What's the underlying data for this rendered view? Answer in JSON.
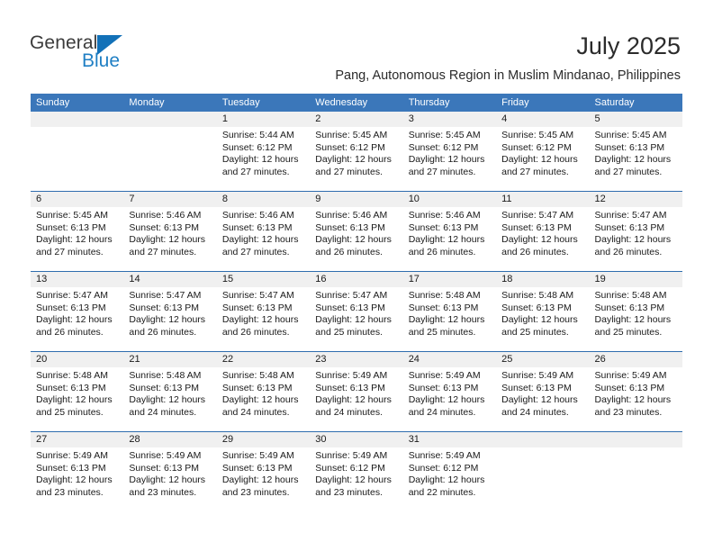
{
  "brand": {
    "name_top": "General",
    "name_bottom": "Blue",
    "triangle_color": "#1271b8",
    "blue_text_color": "#1f7fc4"
  },
  "header": {
    "title": "July 2025",
    "subtitle": "Pang, Autonomous Region in Muslim Mindanao, Philippines",
    "header_bg": "#3b77ba",
    "header_text": "#ffffff",
    "daynum_band_bg": "#f0f0f0",
    "row_divider": "#2f6dae"
  },
  "weekday_headers": [
    "Sunday",
    "Monday",
    "Tuesday",
    "Wednesday",
    "Thursday",
    "Friday",
    "Saturday"
  ],
  "weeks": [
    [
      {
        "day": "",
        "sunrise": "",
        "sunset": "",
        "daylight_line1": "",
        "daylight_line2": ""
      },
      {
        "day": "",
        "sunrise": "",
        "sunset": "",
        "daylight_line1": "",
        "daylight_line2": ""
      },
      {
        "day": "1",
        "sunrise": "Sunrise: 5:44 AM",
        "sunset": "Sunset: 6:12 PM",
        "daylight_line1": "Daylight: 12 hours",
        "daylight_line2": "and 27 minutes."
      },
      {
        "day": "2",
        "sunrise": "Sunrise: 5:45 AM",
        "sunset": "Sunset: 6:12 PM",
        "daylight_line1": "Daylight: 12 hours",
        "daylight_line2": "and 27 minutes."
      },
      {
        "day": "3",
        "sunrise": "Sunrise: 5:45 AM",
        "sunset": "Sunset: 6:12 PM",
        "daylight_line1": "Daylight: 12 hours",
        "daylight_line2": "and 27 minutes."
      },
      {
        "day": "4",
        "sunrise": "Sunrise: 5:45 AM",
        "sunset": "Sunset: 6:12 PM",
        "daylight_line1": "Daylight: 12 hours",
        "daylight_line2": "and 27 minutes."
      },
      {
        "day": "5",
        "sunrise": "Sunrise: 5:45 AM",
        "sunset": "Sunset: 6:13 PM",
        "daylight_line1": "Daylight: 12 hours",
        "daylight_line2": "and 27 minutes."
      }
    ],
    [
      {
        "day": "6",
        "sunrise": "Sunrise: 5:45 AM",
        "sunset": "Sunset: 6:13 PM",
        "daylight_line1": "Daylight: 12 hours",
        "daylight_line2": "and 27 minutes."
      },
      {
        "day": "7",
        "sunrise": "Sunrise: 5:46 AM",
        "sunset": "Sunset: 6:13 PM",
        "daylight_line1": "Daylight: 12 hours",
        "daylight_line2": "and 27 minutes."
      },
      {
        "day": "8",
        "sunrise": "Sunrise: 5:46 AM",
        "sunset": "Sunset: 6:13 PM",
        "daylight_line1": "Daylight: 12 hours",
        "daylight_line2": "and 27 minutes."
      },
      {
        "day": "9",
        "sunrise": "Sunrise: 5:46 AM",
        "sunset": "Sunset: 6:13 PM",
        "daylight_line1": "Daylight: 12 hours",
        "daylight_line2": "and 26 minutes."
      },
      {
        "day": "10",
        "sunrise": "Sunrise: 5:46 AM",
        "sunset": "Sunset: 6:13 PM",
        "daylight_line1": "Daylight: 12 hours",
        "daylight_line2": "and 26 minutes."
      },
      {
        "day": "11",
        "sunrise": "Sunrise: 5:47 AM",
        "sunset": "Sunset: 6:13 PM",
        "daylight_line1": "Daylight: 12 hours",
        "daylight_line2": "and 26 minutes."
      },
      {
        "day": "12",
        "sunrise": "Sunrise: 5:47 AM",
        "sunset": "Sunset: 6:13 PM",
        "daylight_line1": "Daylight: 12 hours",
        "daylight_line2": "and 26 minutes."
      }
    ],
    [
      {
        "day": "13",
        "sunrise": "Sunrise: 5:47 AM",
        "sunset": "Sunset: 6:13 PM",
        "daylight_line1": "Daylight: 12 hours",
        "daylight_line2": "and 26 minutes."
      },
      {
        "day": "14",
        "sunrise": "Sunrise: 5:47 AM",
        "sunset": "Sunset: 6:13 PM",
        "daylight_line1": "Daylight: 12 hours",
        "daylight_line2": "and 26 minutes."
      },
      {
        "day": "15",
        "sunrise": "Sunrise: 5:47 AM",
        "sunset": "Sunset: 6:13 PM",
        "daylight_line1": "Daylight: 12 hours",
        "daylight_line2": "and 26 minutes."
      },
      {
        "day": "16",
        "sunrise": "Sunrise: 5:47 AM",
        "sunset": "Sunset: 6:13 PM",
        "daylight_line1": "Daylight: 12 hours",
        "daylight_line2": "and 25 minutes."
      },
      {
        "day": "17",
        "sunrise": "Sunrise: 5:48 AM",
        "sunset": "Sunset: 6:13 PM",
        "daylight_line1": "Daylight: 12 hours",
        "daylight_line2": "and 25 minutes."
      },
      {
        "day": "18",
        "sunrise": "Sunrise: 5:48 AM",
        "sunset": "Sunset: 6:13 PM",
        "daylight_line1": "Daylight: 12 hours",
        "daylight_line2": "and 25 minutes."
      },
      {
        "day": "19",
        "sunrise": "Sunrise: 5:48 AM",
        "sunset": "Sunset: 6:13 PM",
        "daylight_line1": "Daylight: 12 hours",
        "daylight_line2": "and 25 minutes."
      }
    ],
    [
      {
        "day": "20",
        "sunrise": "Sunrise: 5:48 AM",
        "sunset": "Sunset: 6:13 PM",
        "daylight_line1": "Daylight: 12 hours",
        "daylight_line2": "and 25 minutes."
      },
      {
        "day": "21",
        "sunrise": "Sunrise: 5:48 AM",
        "sunset": "Sunset: 6:13 PM",
        "daylight_line1": "Daylight: 12 hours",
        "daylight_line2": "and 24 minutes."
      },
      {
        "day": "22",
        "sunrise": "Sunrise: 5:48 AM",
        "sunset": "Sunset: 6:13 PM",
        "daylight_line1": "Daylight: 12 hours",
        "daylight_line2": "and 24 minutes."
      },
      {
        "day": "23",
        "sunrise": "Sunrise: 5:49 AM",
        "sunset": "Sunset: 6:13 PM",
        "daylight_line1": "Daylight: 12 hours",
        "daylight_line2": "and 24 minutes."
      },
      {
        "day": "24",
        "sunrise": "Sunrise: 5:49 AM",
        "sunset": "Sunset: 6:13 PM",
        "daylight_line1": "Daylight: 12 hours",
        "daylight_line2": "and 24 minutes."
      },
      {
        "day": "25",
        "sunrise": "Sunrise: 5:49 AM",
        "sunset": "Sunset: 6:13 PM",
        "daylight_line1": "Daylight: 12 hours",
        "daylight_line2": "and 24 minutes."
      },
      {
        "day": "26",
        "sunrise": "Sunrise: 5:49 AM",
        "sunset": "Sunset: 6:13 PM",
        "daylight_line1": "Daylight: 12 hours",
        "daylight_line2": "and 23 minutes."
      }
    ],
    [
      {
        "day": "27",
        "sunrise": "Sunrise: 5:49 AM",
        "sunset": "Sunset: 6:13 PM",
        "daylight_line1": "Daylight: 12 hours",
        "daylight_line2": "and 23 minutes."
      },
      {
        "day": "28",
        "sunrise": "Sunrise: 5:49 AM",
        "sunset": "Sunset: 6:13 PM",
        "daylight_line1": "Daylight: 12 hours",
        "daylight_line2": "and 23 minutes."
      },
      {
        "day": "29",
        "sunrise": "Sunrise: 5:49 AM",
        "sunset": "Sunset: 6:13 PM",
        "daylight_line1": "Daylight: 12 hours",
        "daylight_line2": "and 23 minutes."
      },
      {
        "day": "30",
        "sunrise": "Sunrise: 5:49 AM",
        "sunset": "Sunset: 6:12 PM",
        "daylight_line1": "Daylight: 12 hours",
        "daylight_line2": "and 23 minutes."
      },
      {
        "day": "31",
        "sunrise": "Sunrise: 5:49 AM",
        "sunset": "Sunset: 6:12 PM",
        "daylight_line1": "Daylight: 12 hours",
        "daylight_line2": "and 22 minutes."
      },
      {
        "day": "",
        "sunrise": "",
        "sunset": "",
        "daylight_line1": "",
        "daylight_line2": ""
      },
      {
        "day": "",
        "sunrise": "",
        "sunset": "",
        "daylight_line1": "",
        "daylight_line2": ""
      }
    ]
  ]
}
